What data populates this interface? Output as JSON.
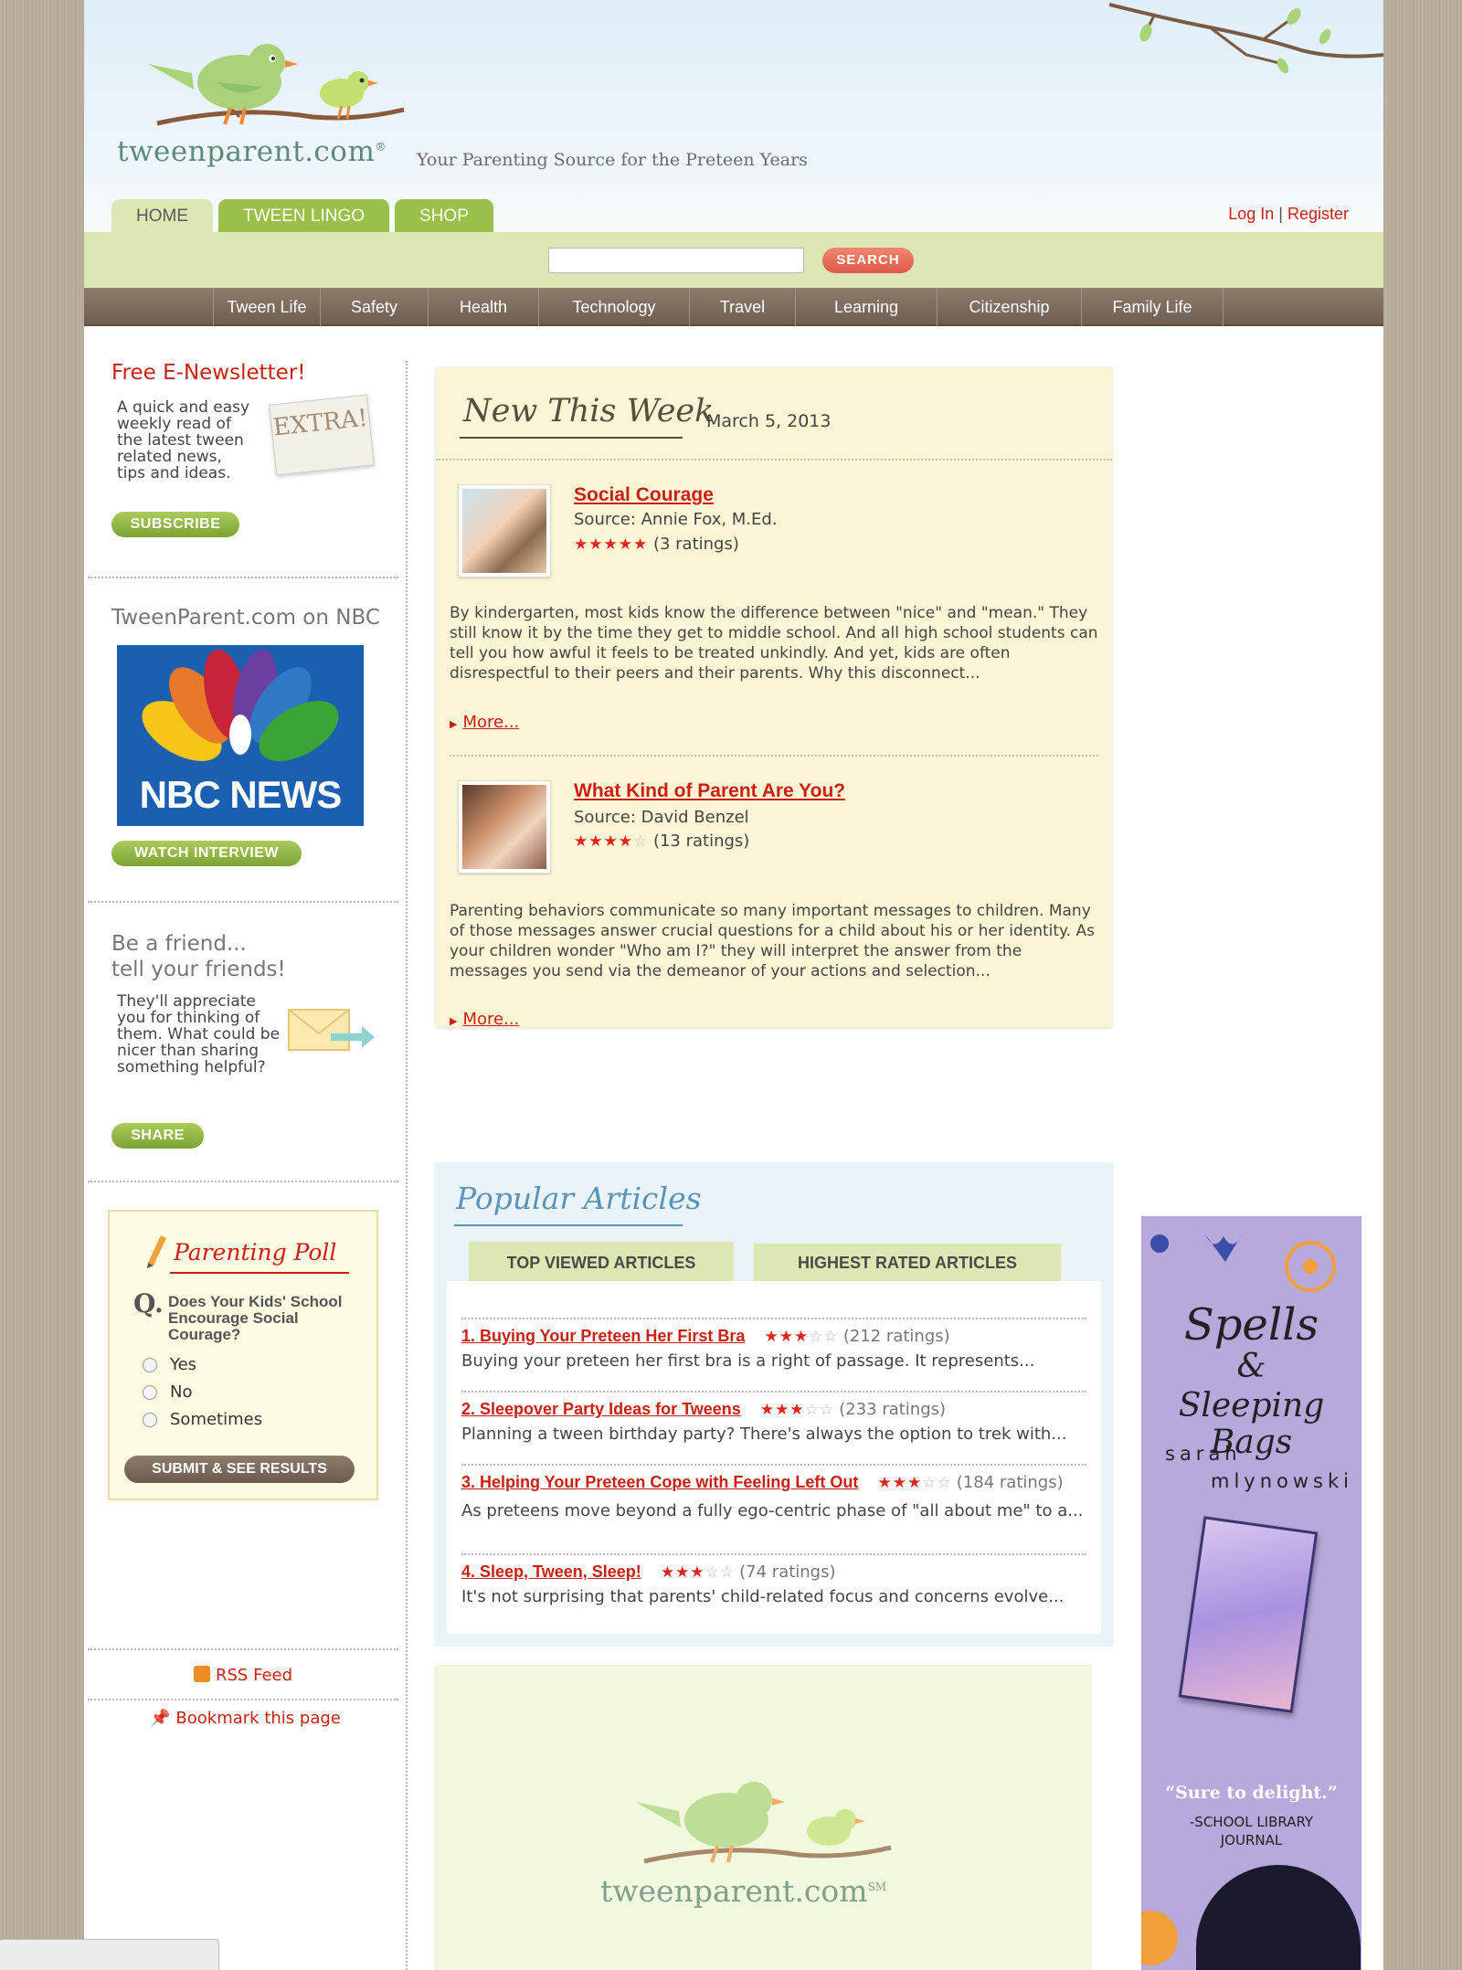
{
  "site": {
    "logo_text": "tweenparent.com",
    "logo_mark": "®",
    "tagline": "Your Parenting Source for the Preteen Years"
  },
  "tabs": [
    {
      "label": "HOME"
    },
    {
      "label": "TWEEN LINGO"
    },
    {
      "label": "SHOP"
    }
  ],
  "auth": {
    "login": "Log In",
    "separator": "|",
    "register": "Register"
  },
  "search": {
    "button": "SEARCH",
    "placeholder": ""
  },
  "nav": [
    {
      "label": "Tween Life"
    },
    {
      "label": "Safety"
    },
    {
      "label": "Health"
    },
    {
      "label": "Technology"
    },
    {
      "label": "Travel"
    },
    {
      "label": "Learning"
    },
    {
      "label": "Citizenship"
    },
    {
      "label": "Family Life"
    }
  ],
  "sidebar": {
    "newsletter": {
      "title": "Free E-Newsletter!",
      "text": "A quick and easy weekly read of the latest tween related news, tips and ideas.",
      "button": "SUBSCRIBE",
      "graphic_text": "EXTRA!"
    },
    "nbc": {
      "title": "TweenParent.com on NBC",
      "logo_text": "NBC NEWS",
      "button": "WATCH INTERVIEW"
    },
    "share": {
      "title_line1": "Be a friend...",
      "title_line2": "tell your friends!",
      "text": "They'll appreciate you for thinking of them. What could be nicer than sharing something helpful?",
      "button": "SHARE"
    },
    "poll": {
      "title": "Parenting Poll",
      "q_marker": "Q.",
      "question": "Does Your Kids' School Encourage Social Courage?",
      "options": [
        "Yes",
        "No",
        "Sometimes"
      ],
      "button": "SUBMIT & SEE RESULTS"
    },
    "rss": "RSS Feed",
    "bookmark": "Bookmark this page"
  },
  "new_this_week": {
    "title": "New This Week",
    "date": "March 5, 2013",
    "articles": [
      {
        "title": "Social Courage",
        "source": "Source: Annie Fox, M.Ed.",
        "rating": 5,
        "ratings_text": "(3 ratings)",
        "body": "By kindergarten, most kids know the difference between \"nice\" and \"mean.\" They still know it by the time they get to middle school. And all high school students can tell you how awful it feels to be treated unkindly. And yet, kids are often disrespectful to their peers and their parents. Why this disconnect...",
        "more": "More..."
      },
      {
        "title": "What Kind of Parent Are You?",
        "source": "Source: David Benzel",
        "rating": 4,
        "ratings_text": "(13 ratings)",
        "body": "Parenting behaviors communicate so many important messages to children. Many of those messages answer crucial questions for a child about his or her identity. As your children wonder \"Who am I?\" they will interpret the answer from the messages you send via the demeanor of your actions and selection...",
        "more": "More..."
      }
    ]
  },
  "popular": {
    "title": "Popular Articles",
    "tabs": [
      "TOP VIEWED ARTICLES",
      "HIGHEST RATED ARTICLES"
    ],
    "items": [
      {
        "title": "1. Buying Your Preteen Her First Bra",
        "rating": 3,
        "ratings_text": "(212 ratings)",
        "excerpt": "Buying your preteen her first bra is a right of passage.  It represents..."
      },
      {
        "title": "2. Sleepover Party Ideas for Tweens",
        "rating": 3,
        "ratings_text": "(233 ratings)",
        "excerpt": "Planning a tween birthday party? There's always the option to trek with..."
      },
      {
        "title": "3. Helping Your Preteen Cope with Feeling Left Out",
        "rating": 3,
        "ratings_text": "(184 ratings)",
        "excerpt": "As preteens move beyond a fully ego-centric phase of \"all about me\" to a..."
      },
      {
        "title": "4. Sleep, Tween, Sleep!",
        "rating": 3,
        "ratings_text": "(74 ratings)",
        "excerpt": "It's not surprising that parents' child-related focus and concerns evolve..."
      }
    ]
  },
  "promo": {
    "logo_text": "tweenparent.com",
    "logo_mark": "SM"
  },
  "ad": {
    "title_line1": "Spells",
    "title_line2": "&",
    "title_line3": "Sleeping Bags",
    "author_line1": "sarah",
    "author_line2": "mlynowski",
    "quote": "“Sure to delight.”",
    "quote_source_line1": "-SCHOOL LIBRARY",
    "quote_source_line2": "JOURNAL"
  },
  "colors": {
    "accent_red": "#cc1f12",
    "tab_green": "#9ac04b",
    "light_green": "#dbe8b4",
    "nav_brown": "#7d6c5e",
    "new_week_bg": "#faf6d5",
    "popular_bg": "#eaf3f8",
    "ad_purple": "#b7a9dc"
  }
}
